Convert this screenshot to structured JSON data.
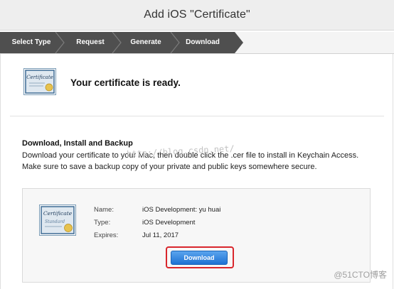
{
  "window": {
    "title": "Add iOS \"Certificate\""
  },
  "steps": [
    {
      "label": "Select Type"
    },
    {
      "label": "Request"
    },
    {
      "label": "Generate"
    },
    {
      "label": "Download"
    }
  ],
  "header": {
    "cert_icon": {
      "icon": "certificate-icon",
      "script_text": "Certificate"
    },
    "message": "Your certificate is ready."
  },
  "section": {
    "title": "Download, Install and Backup",
    "text": "Download your certificate to your Mac, then double click the .cer file to install in Keychain Access. Make sure to save a backup copy of your private and public keys somewhere secure."
  },
  "certificate": {
    "icon": "certificate-standard-icon",
    "script_text": "Certificate",
    "script_sub": "Standard",
    "fields": [
      {
        "label": "Name:",
        "value": "iOS Development: yu huai"
      },
      {
        "label": "Type:",
        "value": "iOS Development"
      },
      {
        "label": "Expires:",
        "value": "Jul 11, 2017"
      }
    ],
    "download_label": "Download"
  },
  "watermark": {
    "text": "http://blog.csdn.net/",
    "corner": "@51CTO博客"
  },
  "colors": {
    "step_bar": "#4f4f4f",
    "step_sep": "#7c7c7c",
    "button": "#1e72d3",
    "highlight": "#d9262c"
  }
}
